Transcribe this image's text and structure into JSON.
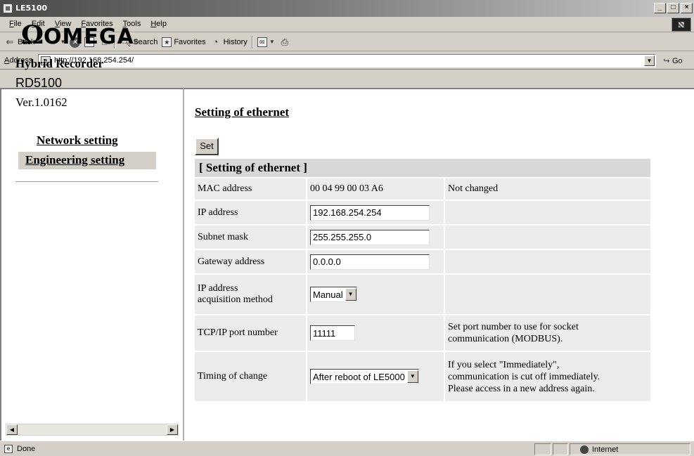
{
  "window": {
    "title": "LE5100",
    "controls": [
      "_",
      "□",
      "×"
    ]
  },
  "menu": [
    "File",
    "Edit",
    "View",
    "Favorites",
    "Tools",
    "Help"
  ],
  "toolbar": {
    "back": "Back",
    "search": "Search",
    "favorites": "Favorites",
    "history": "History"
  },
  "address": {
    "label": "Address",
    "url": "http://192.168.254.254/",
    "go": "Go"
  },
  "sidebar": {
    "brand": "OMEGA",
    "product": "Hybrid Recorder",
    "model": "RD5100",
    "version": "Ver.1.0162",
    "links": [
      "Network setting",
      "Engineering setting"
    ]
  },
  "main": {
    "heading": "Setting of ethernet",
    "set_button": "Set",
    "table_title": "[ Setting of ethernet ]",
    "rows": {
      "mac": {
        "label": "MAC address",
        "value": "00 04 99 00 03 A6",
        "note": "Not changed"
      },
      "ip": {
        "label": "IP address",
        "value": "192.168.254.254"
      },
      "subnet": {
        "label": "Subnet mask",
        "value": "255.255.255.0"
      },
      "gateway": {
        "label": "Gateway address",
        "value": "0.0.0.0"
      },
      "method": {
        "label_line1": "IP address",
        "label_line2": "acquisition method",
        "value": "Manual"
      },
      "port": {
        "label": "TCP/IP port number",
        "value": "11111",
        "note_line1": "Set port number to use for socket",
        "note_line2": "communication (MODBUS)."
      },
      "timing": {
        "label": "Timing of change",
        "value": "After reboot of LE5000",
        "note_line1": "If you select \"Immediately\",",
        "note_line2": "communication is cut off immediately.",
        "note_line3": "Please access in a new address again."
      }
    }
  },
  "status": {
    "text": "Done",
    "zone": "Internet"
  }
}
